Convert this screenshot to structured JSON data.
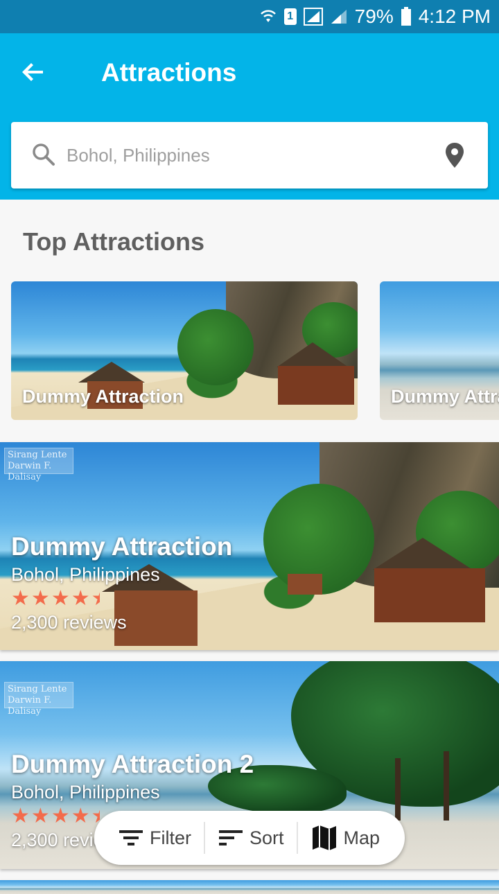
{
  "status_bar": {
    "battery": "79%",
    "time": "4:12 PM",
    "sim": "1"
  },
  "app_bar": {
    "title": "Attractions"
  },
  "search": {
    "placeholder": "Bohol, Philippines"
  },
  "top_section": {
    "title": "Top Attractions",
    "items": [
      {
        "label": "Dummy Attraction"
      },
      {
        "label": "Dummy Attraction"
      }
    ]
  },
  "cards": [
    {
      "title": "Dummy Attraction",
      "location": "Bohol, Philippines",
      "rating": 4.5,
      "reviews": "2,300 reviews",
      "watermark": "Sirang Lente\nDarwin F. Dalisay"
    },
    {
      "title": "Dummy Attraction 2",
      "location": "Bohol, Philippines",
      "rating": 4.5,
      "reviews": "2,300 reviews",
      "watermark": "Sirang Lente\nDarwin F. Dalisay"
    }
  ],
  "actions": {
    "filter": "Filter",
    "sort": "Sort",
    "map": "Map"
  },
  "colors": {
    "primary": "#03b4e8",
    "status_bar": "#0f7fb0",
    "star": "#f36b4b"
  }
}
